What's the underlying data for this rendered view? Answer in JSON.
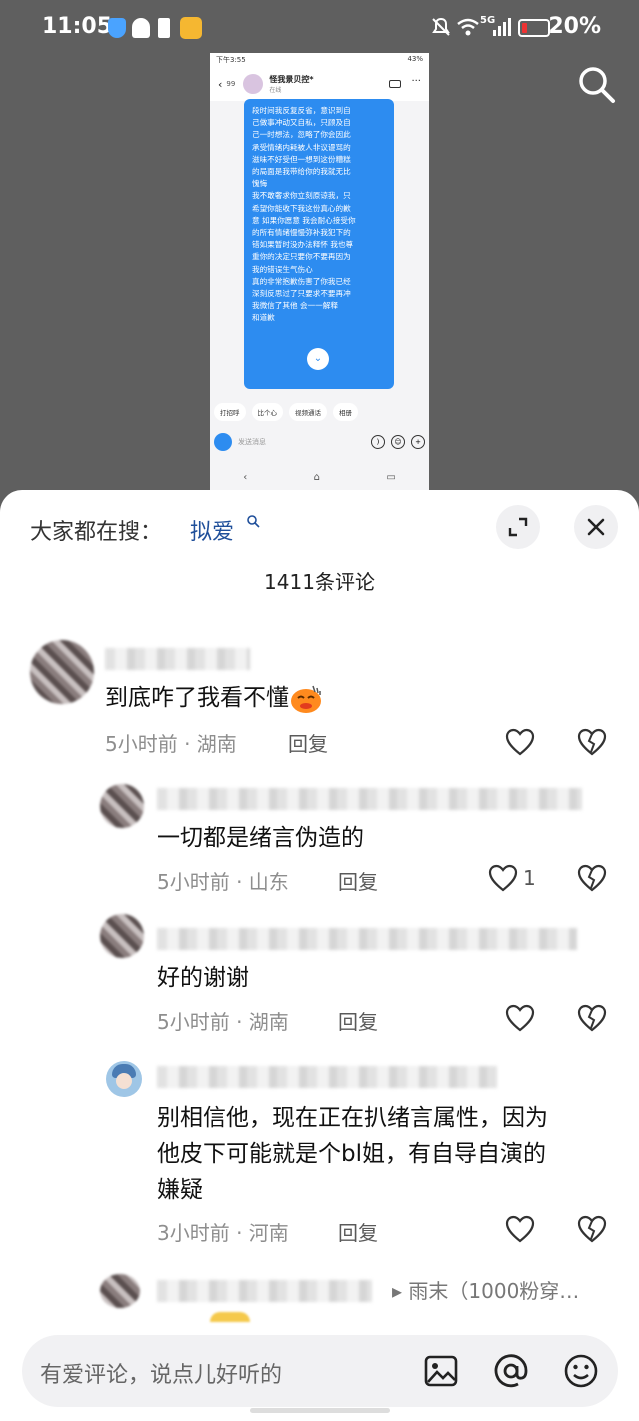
{
  "status_bar": {
    "time": "11:05",
    "battery": "20%",
    "network": "5G"
  },
  "embedded_screenshot": {
    "status_time": "下午3:55",
    "status_battery": "43%",
    "unread": "99",
    "contact_name": "怪我景贝控*",
    "contact_status": "在线",
    "message_lines": [
      "段时间我反复反省，意识到自",
      "己做事冲动又自私，只顾及自",
      "己一时想法，忽略了你会因此",
      "承受情绪内耗被人非议谩骂的",
      "滋味不好受但一想到这份糟糕",
      "的局面是我带给你的我就无比",
      "愧悔",
      "我不敢奢求你立刻原谅我，只",
      "希望你能收下我这份真心的歉",
      "意 如果你愿意 我会耐心接受你",
      "的所有情绪慢慢弥补我犯下的",
      "错如果暂时没办法释怀 我也尊",
      "重你的决定只要你不要再因为",
      "我的错误生气伤心",
      "真的非常抱歉伤害了你我已经",
      "深刻反思过了只要求不要再冲",
      "我微信了其他 会一一解释",
      "和道歉"
    ],
    "chips": [
      "打招呼",
      "比个心",
      "视频通话",
      "相册"
    ],
    "input_placeholder": "发送消息"
  },
  "sheet": {
    "trend_label": "大家都在搜：",
    "trend_keyword": "拟爱",
    "comment_count": "1411条评论"
  },
  "comments": [
    {
      "text": "到底咋了我看不懂",
      "meta": "5小时前 · 湖南",
      "reply": "回复",
      "likes": ""
    },
    {
      "text": "一切都是绪言伪造的",
      "meta": "5小时前 · 山东",
      "reply": "回复",
      "likes": "1"
    },
    {
      "text": "好的谢谢",
      "meta": "5小时前 · 湖南",
      "reply": "回复",
      "likes": ""
    },
    {
      "text_line1": "别相信他，现在正在扒绪言属性，因为",
      "text_line2": "他皮下可能就是个bl姐，有自导自演的",
      "text_line3": "嫌疑",
      "meta": "3小时前 · 河南",
      "reply": "回复",
      "likes": ""
    }
  ],
  "partial_reply_to": "▸ 雨末（1000粉穿…",
  "input_bar": {
    "placeholder": "有爱评论，说点儿好听的"
  },
  "icons": {
    "search": "search-icon",
    "expand": "expand-icon",
    "close": "close-icon",
    "like": "heart-icon",
    "dislike": "broken-heart-icon",
    "image": "image-icon",
    "mention": "at-icon",
    "emoji": "smile-icon"
  }
}
